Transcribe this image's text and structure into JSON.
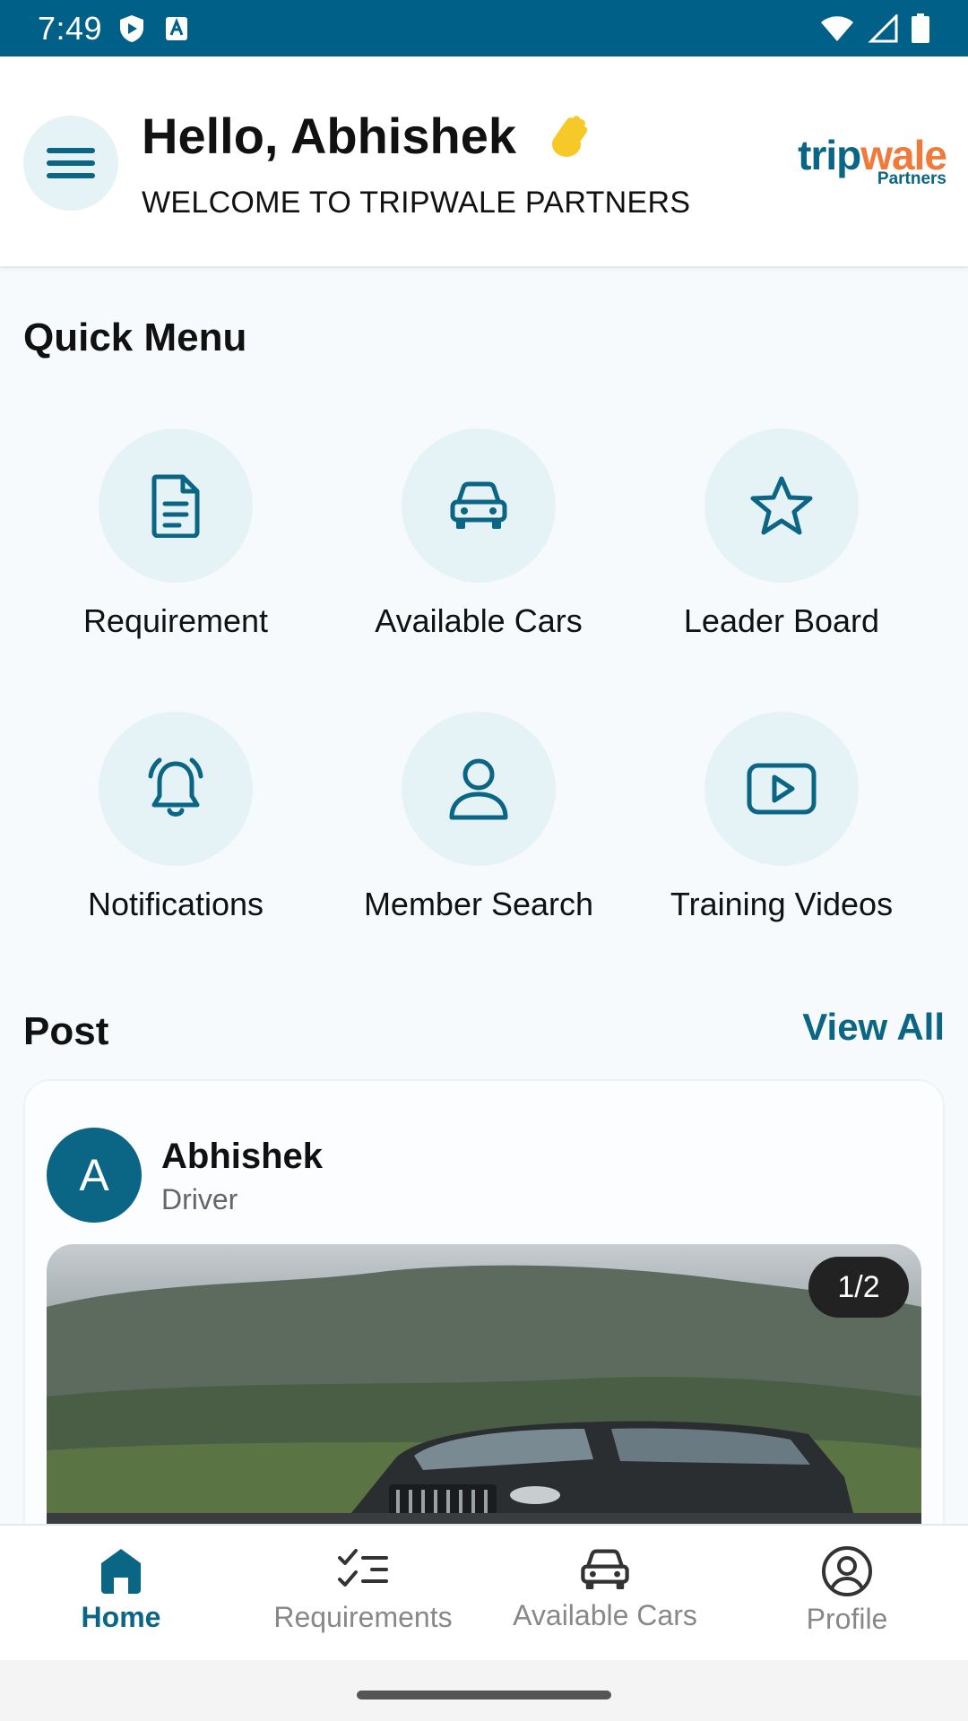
{
  "status_bar": {
    "time": "7:49",
    "icons": [
      "shield-icon",
      "keyboard-a-icon",
      "wifi-icon",
      "signal-icon",
      "battery-icon"
    ]
  },
  "header": {
    "greeting": "Hello, Abhishek",
    "greeting_icon": "waving-hand-icon",
    "subtitle": "WELCOME TO TRIPWALE PARTNERS",
    "logo_part1": "trip",
    "logo_part2": "wale",
    "logo_tagline": "Partners"
  },
  "quick_menu": {
    "title": "Quick Menu",
    "items": [
      {
        "label": "Requirement",
        "icon": "document-icon"
      },
      {
        "label": "Available Cars",
        "icon": "car-icon"
      },
      {
        "label": "Leader Board",
        "icon": "star-icon"
      },
      {
        "label": "Notifications",
        "icon": "bell-icon"
      },
      {
        "label": "Member Search",
        "icon": "user-icon"
      },
      {
        "label": "Training Videos",
        "icon": "play-video-icon"
      }
    ]
  },
  "post_section": {
    "title": "Post",
    "view_all": "View All",
    "post": {
      "avatar_initial": "A",
      "author": "Abhishek",
      "role": "Driver",
      "image_counter": "1/2"
    }
  },
  "bottom_nav": {
    "items": [
      {
        "label": "Home",
        "icon": "home-icon",
        "active": true
      },
      {
        "label": "Requirements",
        "icon": "checklist-icon",
        "active": false
      },
      {
        "label": "Available Cars",
        "icon": "car-icon",
        "active": false
      },
      {
        "label": "Profile",
        "icon": "profile-icon",
        "active": false
      }
    ]
  },
  "colors": {
    "primary": "#0b6585",
    "status_bar": "#006088",
    "accent_orange": "#f07a3a",
    "icon_circle": "#e6f3f6"
  }
}
